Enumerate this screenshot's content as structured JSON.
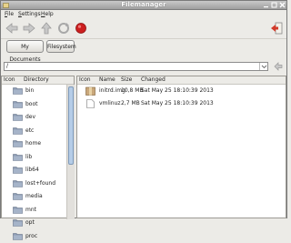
{
  "window": {
    "title": "Filemanager"
  },
  "menubar": [
    {
      "label": "File",
      "accel": "F",
      "rest": "ile"
    },
    {
      "label": "Settings",
      "accel": "S",
      "rest": "ettings"
    },
    {
      "label": "Help",
      "accel": "H",
      "rest": "elp"
    }
  ],
  "toolbar": {
    "icons": [
      "back-icon",
      "forward-icon",
      "up-icon",
      "refresh-icon",
      "stop-icon",
      "exit-icon"
    ]
  },
  "places": {
    "my_documents": "My Documents",
    "filesystem": "Filesystem"
  },
  "path": {
    "value": "/"
  },
  "dir_panel": {
    "headers": {
      "icon": "Icon",
      "directory": "Directory"
    },
    "items": [
      "bin",
      "boot",
      "dev",
      "etc",
      "home",
      "lib",
      "lib64",
      "lost+found",
      "media",
      "mnt",
      "opt",
      "proc"
    ]
  },
  "file_panel": {
    "headers": {
      "icon": "Icon",
      "name": "Name",
      "size": "Size",
      "changed": "Changed"
    },
    "rows": [
      {
        "name": "initrd.img",
        "size": "10,8 MB",
        "changed": "Sat May 25 18:10:39 2013",
        "icon": "archive-icon"
      },
      {
        "name": "vmlinuz",
        "size": "2,7 MB",
        "changed": "Sat May 25 18:10:39 2013",
        "icon": "document-icon"
      }
    ]
  },
  "colors": {
    "accent": "#b5cde8",
    "stop": "#cc1f1f",
    "folder": "#8e9db4"
  }
}
